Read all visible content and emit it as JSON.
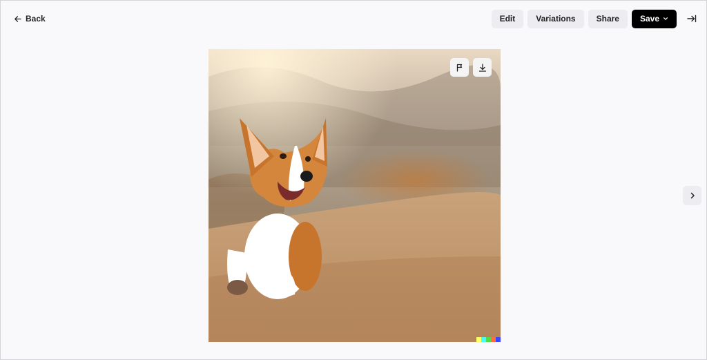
{
  "header": {
    "back_label": "Back",
    "back_icon": "arrow-left-icon"
  },
  "toolbar": {
    "edit_label": "Edit",
    "variations_label": "Variations",
    "share_label": "Share",
    "save_label": "Save",
    "save_icon": "chevron-down-icon",
    "collapse_icon": "collapse-right-icon"
  },
  "image": {
    "subject": "corgi running on dirt path",
    "actions": [
      {
        "icon": "flag-icon"
      },
      {
        "icon": "download-icon"
      }
    ],
    "signature_colors": [
      "#ffff66",
      "#42ffff",
      "#51da4c",
      "#ff6e3c",
      "#3c46ff"
    ]
  },
  "navigation": {
    "next_icon": "chevron-right-icon"
  },
  "colors": {
    "background": "#f9f9fb",
    "primary_button": "#000000",
    "secondary_button": "#ececf1"
  }
}
